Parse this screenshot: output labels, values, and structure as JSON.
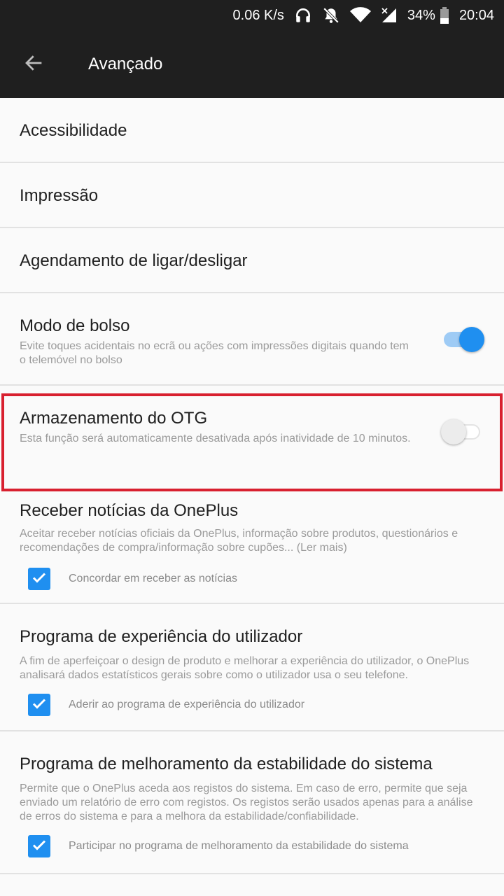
{
  "colors": {
    "bar_bg": "#1f1f1f",
    "accent": "#1f8ff0",
    "highlight": "#d8202f"
  },
  "status_bar": {
    "speed": "0.06 K/s",
    "icons": [
      "headset-icon",
      "bell-off-icon",
      "wifi-icon",
      "cell-signal-off-icon",
      "battery-icon"
    ],
    "battery": "34%",
    "time": "20:04"
  },
  "app_bar": {
    "back_icon": "arrow-left-icon",
    "title": "Avançado"
  },
  "items": [
    {
      "title": "Acessibilidade"
    },
    {
      "title": "Impressão"
    },
    {
      "title": "Agendamento de ligar/desligar"
    }
  ],
  "pocket_mode": {
    "title": "Modo de bolso",
    "subtitle": "Evite toques acidentais no ecrã ou ações com impressões digitais quando tem o telemóvel no bolso",
    "enabled": true
  },
  "otg": {
    "title": "Armazenamento do OTG",
    "subtitle": "Esta função será automaticamente desativada após inatividade de 10 minutos.",
    "enabled": false
  },
  "oneplus_news": {
    "title": "Receber notícias da OnePlus",
    "subtitle": "Aceitar receber notícias oficiais da OnePlus, informação sobre produtos, questionários e recomendações de compra/informação sobre cupões... (Ler mais)",
    "checkbox_label": "Concordar em receber as notícias",
    "checked": true
  },
  "user_experience": {
    "title": "Programa de experiência do utilizador",
    "subtitle": "A fim de aperfeiçoar o design de produto e melhorar a experiência do utilizador, o OnePlus analisará dados estatísticos gerais sobre como o utilizador usa o seu telefone.",
    "checkbox_label": "Aderir ao programa de experiência do utilizador",
    "checked": true
  },
  "stability": {
    "title": "Programa de melhoramento da estabilidade do sistema",
    "subtitle": "Permite que o OnePlus aceda aos registos do sistema. Em caso de erro, permite que seja enviado um relatório de erro com registos. Os registos serão usados apenas para a análise de erros do sistema e para a melhora da estabilidade/confiabilidade.",
    "checkbox_label": "Participar no programa de melhoramento da estabilidade do sistema",
    "checked": true
  }
}
